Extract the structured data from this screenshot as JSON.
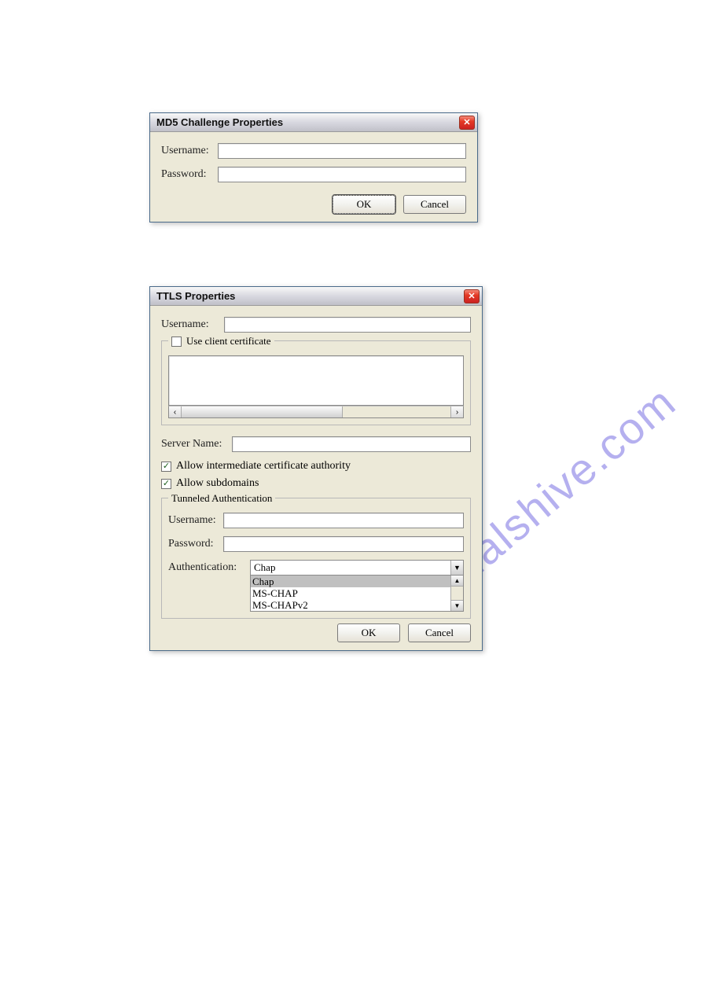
{
  "watermark": "manualshive.com",
  "dialog1": {
    "title": "MD5 Challenge Properties",
    "username_label": "Username:",
    "password_label": "Password:",
    "username_value": "",
    "password_value": "",
    "ok": "OK",
    "cancel": "Cancel"
  },
  "dialog2": {
    "title": "TTLS Properties",
    "username_label": "Username:",
    "username_value": "",
    "use_client_cert_label": "Use client certificate",
    "use_client_cert_checked": false,
    "server_name_label": "Server Name:",
    "server_name_value": "",
    "allow_intermediate_label": "Allow intermediate certificate authority",
    "allow_intermediate_checked": true,
    "allow_subdomains_label": "Allow subdomains",
    "allow_subdomains_checked": true,
    "tunneled_legend": "Tunneled Authentication",
    "t_username_label": "Username:",
    "t_username_value": "",
    "t_password_label": "Password:",
    "t_password_value": "",
    "auth_label": "Authentication:",
    "auth_selected": "Chap",
    "auth_options": [
      "Chap",
      "MS-CHAP",
      "MS-CHAPv2"
    ],
    "ok": "OK",
    "cancel": "Cancel"
  }
}
